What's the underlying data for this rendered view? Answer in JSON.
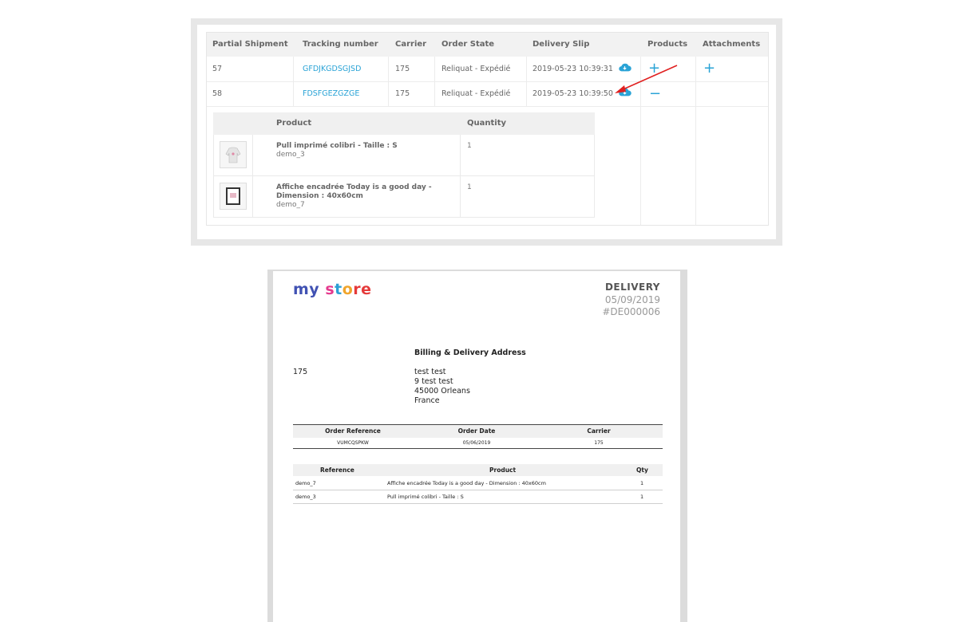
{
  "admin": {
    "columns": [
      "Partial Shipment",
      "Tracking number",
      "Carrier",
      "Order State",
      "Delivery Slip",
      "Products",
      "Attachments"
    ],
    "rows": [
      {
        "id": "57",
        "tracking": "GFDJKGDSGJSD",
        "carrier": "175",
        "state": "Reliquat - Expédié",
        "slip": "2019-05-23 10:39:31",
        "products_toggle": "+",
        "attachments_toggle": "+"
      },
      {
        "id": "58",
        "tracking": "FDSFGEZGZGE",
        "carrier": "175",
        "state": "Reliquat - Expédié",
        "slip": "2019-05-23 10:39:50",
        "products_toggle": "−"
      }
    ],
    "products_table": {
      "headers": [
        "Product",
        "Quantity"
      ],
      "items": [
        {
          "name": "Pull imprimé colibri - Taille : S",
          "reference": "demo_3",
          "quantity": "1"
        },
        {
          "name_line1": "Affiche encadrée Today is a good day -",
          "name_line2": "Dimension : 40x60cm",
          "reference": "demo_7",
          "quantity": "1"
        }
      ]
    },
    "colors": {
      "link": "#2aa3d6",
      "arrow": "#e02020"
    }
  },
  "slip": {
    "logo": {
      "part1": "my",
      "s": "s",
      "t": "t",
      "o": "o",
      "re": "re"
    },
    "title": "DELIVERY",
    "date": "05/09/2019",
    "number": "#DE000006",
    "address_heading": "Billing & Delivery Address",
    "left_value": "175",
    "address_lines": [
      "test test",
      "9 test test",
      "45000 Orleans",
      "France"
    ],
    "order_table": {
      "headers": [
        "Order Reference",
        "Order Date",
        "Carrier"
      ],
      "row": [
        "VUMCQSPKW",
        "05/06/2019",
        "175"
      ]
    },
    "products_table": {
      "headers": [
        "Reference",
        "Product",
        "Qty"
      ],
      "rows": [
        [
          "demo_7",
          "Affiche encadrée Today is a good day - Dimension : 40x60cm",
          "1"
        ],
        [
          "demo_3",
          "Pull imprimé colibri - Taille : S",
          "1"
        ]
      ]
    }
  }
}
